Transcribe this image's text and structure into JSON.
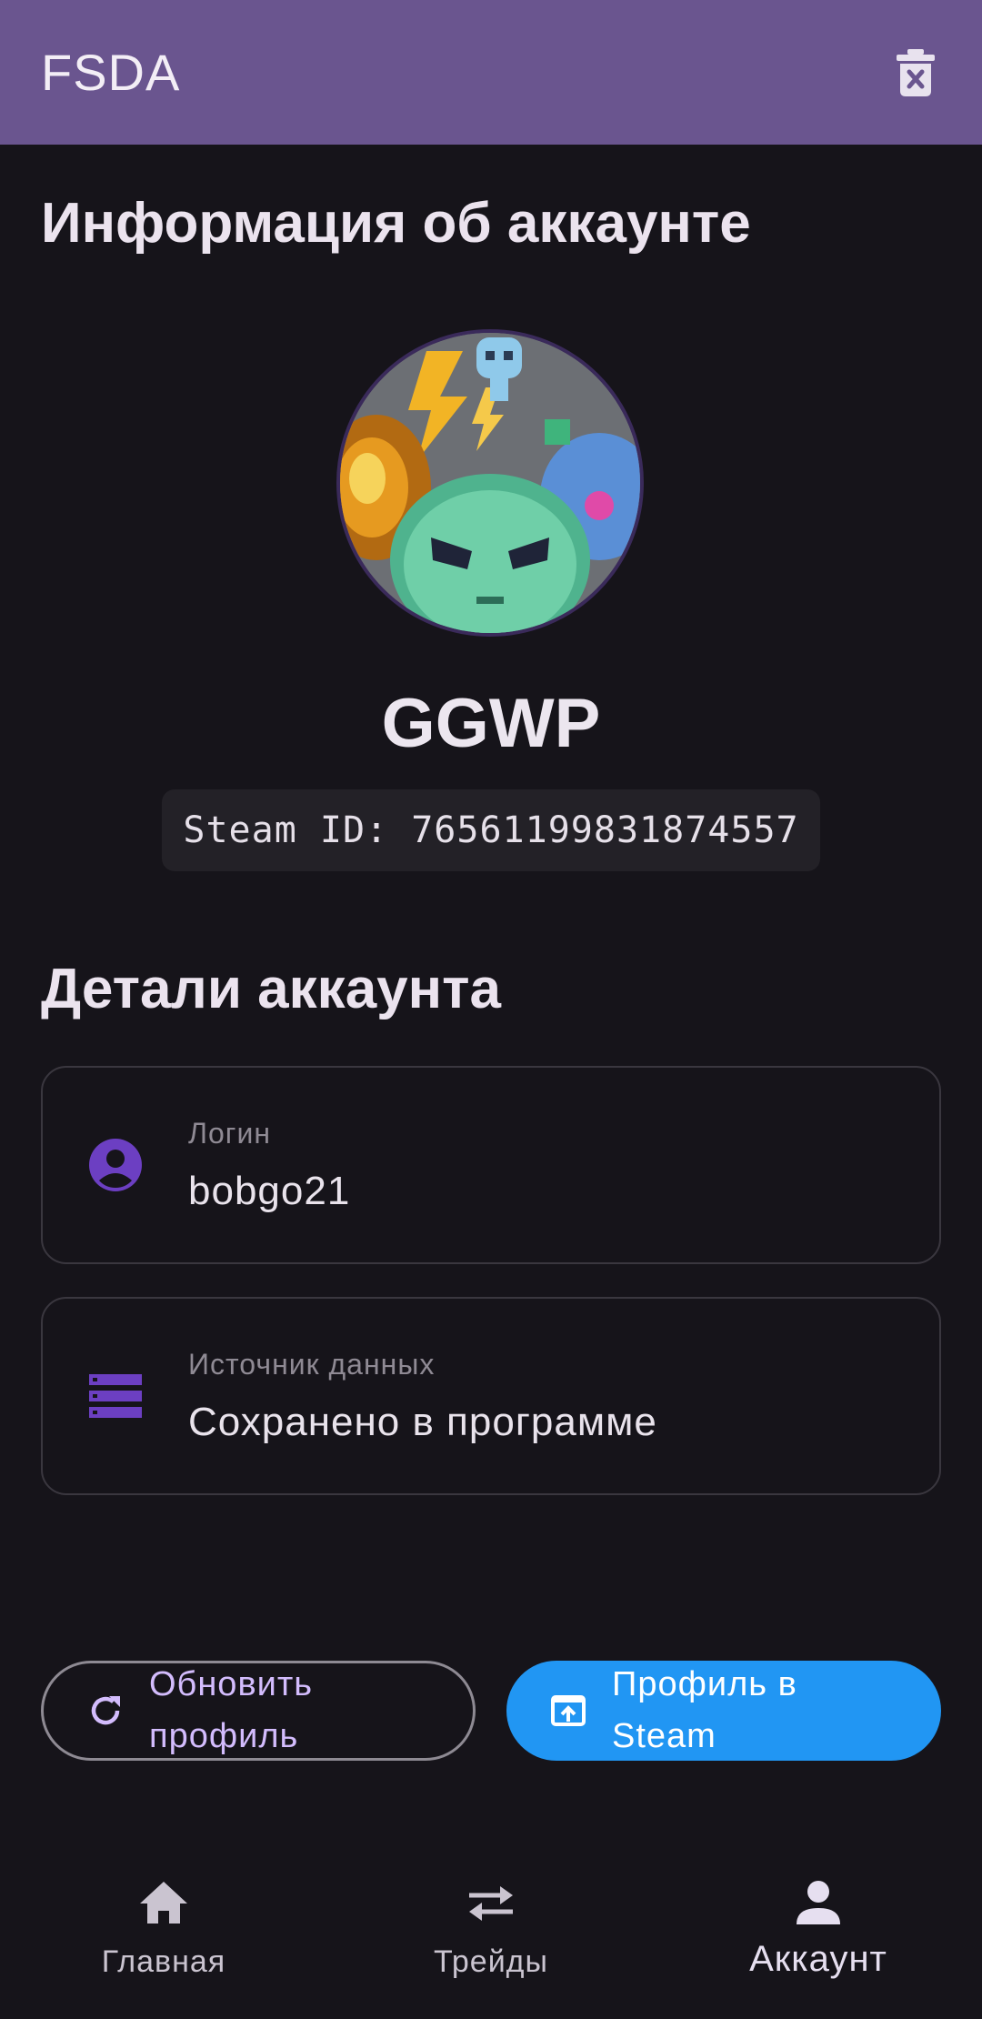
{
  "app_bar": {
    "title": "FSDA",
    "delete_icon": "delete-sweep-icon",
    "background": "#6a558f"
  },
  "account_info": {
    "section_title": "Информация об аккаунте",
    "avatar_icon": "avatar-image",
    "username": "GGWP",
    "steam_id": "Steam ID: 76561199831874557"
  },
  "details": {
    "section_title": "Детали аккаунта",
    "login": {
      "icon": "account-circle-icon",
      "label": "Логин",
      "value": "bobgo21"
    },
    "source": {
      "icon": "storage-icon",
      "label": "Источник данных",
      "value": "Сохранено в программе"
    }
  },
  "actions": {
    "refresh": {
      "icon": "refresh-icon",
      "label": "Обновить профиль",
      "color": "#d3bcfd"
    },
    "steam_profile": {
      "icon": "open-in-new-icon",
      "label": "Профиль в Steam",
      "color": "#2196f3"
    }
  },
  "bottom_nav": {
    "items": [
      {
        "icon": "home-icon",
        "label": "Главная",
        "active": false
      },
      {
        "icon": "swap-icon",
        "label": "Трейды",
        "active": false
      },
      {
        "icon": "person-icon",
        "label": "Аккаунт",
        "active": true
      }
    ]
  },
  "accent_color": "#6c3fc2"
}
